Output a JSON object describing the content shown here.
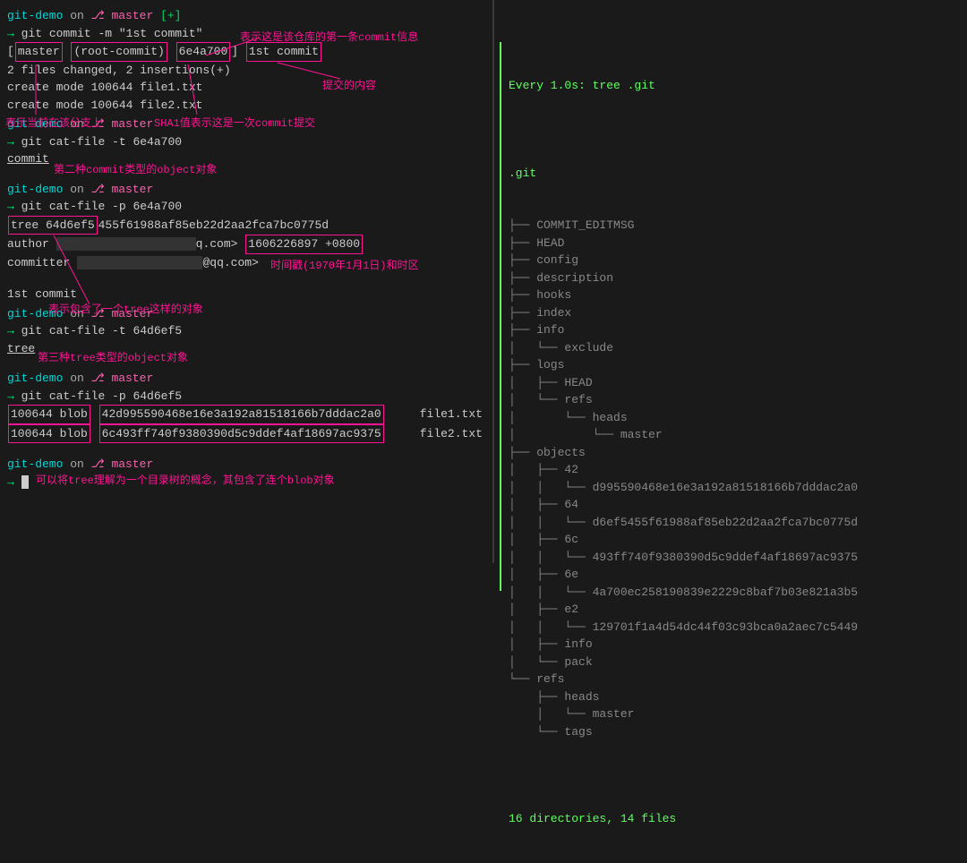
{
  "left": {
    "prompt1": {
      "dir": "git-demo",
      "on": "on",
      "branch": "master",
      "status": "[+]",
      "cmd": "git commit -m \"1st commit\""
    },
    "commit_result": {
      "branch": "master",
      "root": "(root-commit)",
      "hash": "6e4a700",
      "msg": "1st commit",
      "line2": " 2 files changed, 2 insertions(+)",
      "line3": " create mode 100644 file1.txt",
      "line4": " create mode 100644 file2.txt"
    },
    "annot1": "表示这是该仓库的第一条commit信息",
    "annot2": "提交的内容",
    "annot3": "表示当前在该分支上",
    "annot4": "SHA1值表示这是一次commit提交",
    "prompt2": {
      "dir": "git-demo",
      "on": "on",
      "branch": "master",
      "cmd": "git cat-file -t 6e4a700"
    },
    "out2": "commit",
    "annot5": "第二种commit类型的object对象",
    "prompt3": {
      "dir": "git-demo",
      "on": "on",
      "branch": "master",
      "cmd": "git cat-file -p 6e4a700"
    },
    "out3": {
      "tree_label": "tree 64d6ef5",
      "tree_rest": "455f61988af85eb22d2aa2fca7bc0775d",
      "author": "author",
      "ts": "1606226897 +0800",
      "committer_prefix": "committer",
      "committer_email": "@qq.com>",
      "msg": "1st commit"
    },
    "annot6": "时间戳(1970年1月1日)和时区",
    "annot7": "表示包含了一个tree这样的对象",
    "prompt4": {
      "dir": "git-demo",
      "on": "on",
      "branch": "master",
      "cmd": "git cat-file -t 64d6ef5"
    },
    "out4": "tree",
    "annot8": "第三种tree类型的object对象",
    "prompt5": {
      "dir": "git-demo",
      "on": "on",
      "branch": "master",
      "cmd": "git cat-file -p 64d6ef5"
    },
    "out5a_mode": "100644 blob",
    "out5a_hash": "42d995590468e16e3a192a81518166b7dddac2a0",
    "out5a_file": "file1.txt",
    "out5b_mode": "100644 blob",
    "out5b_hash": "6c493ff740f9380390d5c9ddef4af18697ac9375",
    "out5b_file": "file2.txt",
    "prompt6": {
      "dir": "git-demo",
      "on": "on",
      "branch": "master"
    },
    "annot9": "可以将tree理解为一个目录树的概念，其包含了连个blob对象"
  },
  "right": {
    "header": "Every 1.0s: tree .git",
    "root": ".git",
    "tree": [
      "├── COMMIT_EDITMSG",
      "├── HEAD",
      "├── config",
      "├── description",
      "├── hooks",
      "├── index",
      "├── info",
      "│   └── exclude",
      "├── logs",
      "│   ├── HEAD",
      "│   └── refs",
      "│       └── heads",
      "│           └── master",
      "├── objects",
      "│   ├── 42",
      "│   │   └── d995590468e16e3a192a81518166b7dddac2a0",
      "│   ├── 64",
      "│   │   └── d6ef5455f61988af85eb22d2aa2fca7bc0775d",
      "│   ├── 6c",
      "│   │   └── 493ff740f9380390d5c9ddef4af18697ac9375",
      "│   ├── 6e",
      "│   │   └── 4a700ec258190839e2229c8baf7b03e821a3b5",
      "│   ├── e2",
      "│   │   └── 129701f1a4d54dc44f03c93bca0a2aec7c5449",
      "│   ├── info",
      "│   └── pack",
      "└── refs",
      "    ├── heads",
      "    │   └── master",
      "    └── tags"
    ],
    "summary": "16 directories, 14 files"
  }
}
